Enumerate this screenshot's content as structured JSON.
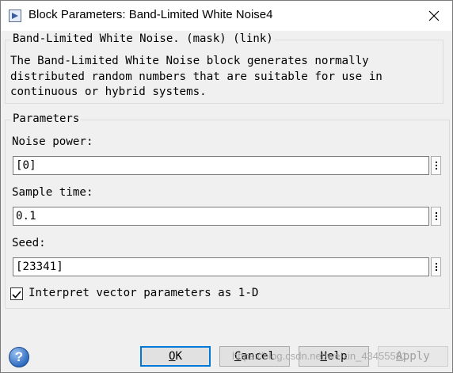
{
  "window": {
    "title": "Block Parameters: Band-Limited White Noise4"
  },
  "mask": {
    "heading": "Band-Limited White Noise. (mask) (link)",
    "description": "The Band-Limited White Noise block generates normally\ndistributed random numbers that are suitable for use in\ncontinuous or hybrid systems."
  },
  "parameters": {
    "heading": "Parameters",
    "fields": [
      {
        "label": "Noise power:",
        "value": "[0]"
      },
      {
        "label": "Sample time:",
        "value": "0.1"
      },
      {
        "label": "Seed:",
        "value": "[23341]"
      }
    ],
    "checkbox": {
      "label": "Interpret vector parameters as 1-D",
      "checked": true
    }
  },
  "buttons": {
    "ok": {
      "mnemonic": "O",
      "rest": "K"
    },
    "cancel": {
      "mnemonic": "C",
      "rest": "ancel"
    },
    "help": {
      "mnemonic": "H",
      "rest": "elp"
    },
    "apply": {
      "mnemonic": "A",
      "rest": "pply"
    }
  },
  "watermark": "https://blog.csdn.net/weixin_43455581",
  "help_glyph": "?"
}
